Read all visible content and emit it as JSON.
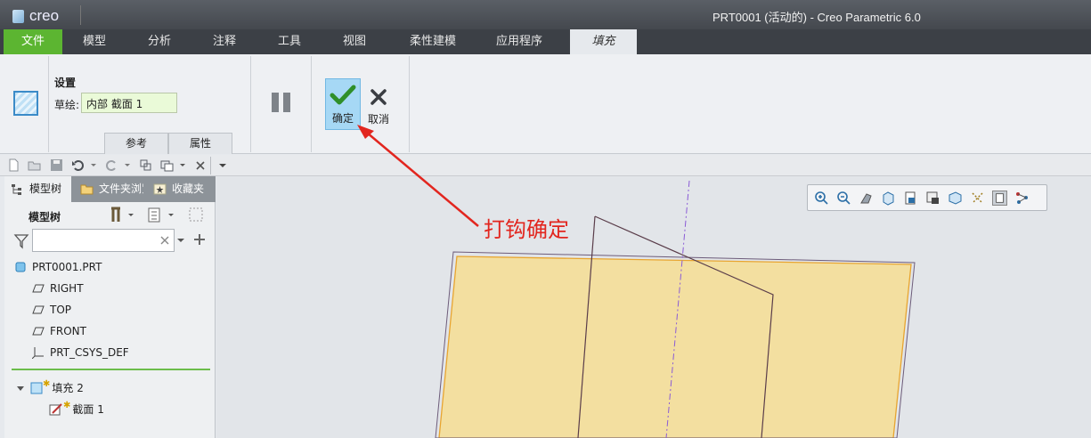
{
  "app": {
    "logo_text": "creo",
    "window_title": "PRT0001 (活动的) - Creo Parametric 6.0"
  },
  "menu": {
    "tabs": [
      "文件",
      "模型",
      "分析",
      "注释",
      "工具",
      "视图",
      "柔性建模",
      "应用程序",
      "填充"
    ],
    "active": "填充"
  },
  "ribbon": {
    "settings_title": "设置",
    "sketch_label": "草绘:",
    "sketch_value": "内部 截面 1",
    "subtabs": [
      "参考",
      "属性"
    ],
    "ok_label": "确定",
    "cancel_label": "取消"
  },
  "left_panel": {
    "tabs": [
      "模型树",
      "文件夹浏览器",
      "收藏夹"
    ],
    "tree_header": "模型树",
    "filter_placeholder": "",
    "items": [
      {
        "label": "PRT0001.PRT",
        "icon": "part-icon"
      },
      {
        "label": "RIGHT",
        "icon": "datum-plane-icon"
      },
      {
        "label": "TOP",
        "icon": "datum-plane-icon"
      },
      {
        "label": "FRONT",
        "icon": "datum-plane-icon"
      },
      {
        "label": "PRT_CSYS_DEF",
        "icon": "csys-icon"
      },
      {
        "label": "填充 2",
        "icon": "fill-feature-icon"
      },
      {
        "label": "截面 1",
        "icon": "sketch-icon"
      }
    ]
  },
  "annotation": {
    "text": "打钩确定",
    "color": "#e2261f"
  },
  "colors": {
    "accent_green": "#5cb531",
    "fill_surface": "#f3dfa0",
    "ok_highlight": "#a6d8f5"
  }
}
